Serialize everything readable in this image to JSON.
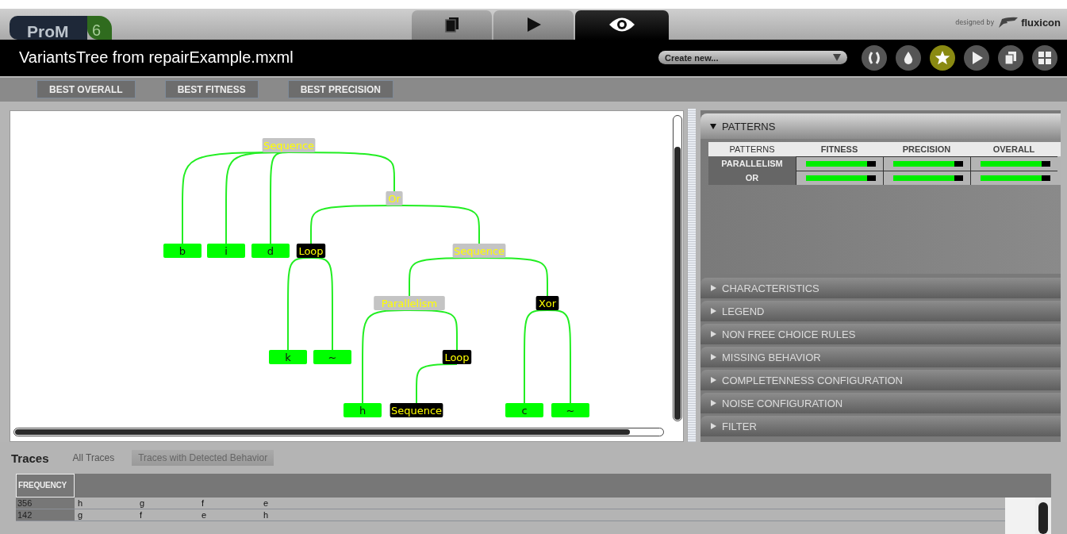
{
  "logo": {
    "name": "ProM",
    "version": "6"
  },
  "view_tabs": [
    {
      "selected": false
    },
    {
      "selected": false
    },
    {
      "selected": true
    }
  ],
  "credit": {
    "prefix": "designed by",
    "brand": "fluxicon"
  },
  "title": "VariantsTree from repairExample.mxml",
  "create_dropdown": {
    "value": "Create new..."
  },
  "action_buttons": [
    {
      "selected": false
    },
    {
      "selected": false
    },
    {
      "selected": true
    },
    {
      "selected": false
    },
    {
      "selected": false
    },
    {
      "selected": false
    }
  ],
  "toolbar_buttons": [
    "BEST OVERALL",
    "BEST FITNESS",
    "BEST PRECISION"
  ],
  "tree": {
    "root": {
      "label": "Sequence",
      "kind": "operator",
      "children": [
        {
          "label": "b",
          "kind": "leaf"
        },
        {
          "label": "i",
          "kind": "leaf"
        },
        {
          "label": "d",
          "kind": "leaf"
        },
        {
          "label": "Or",
          "kind": "operator",
          "children": [
            {
              "label": "Loop",
              "kind": "operator-dark",
              "children": [
                {
                  "label": "k",
                  "kind": "leaf"
                },
                {
                  "label": "~",
                  "kind": "leaf"
                }
              ]
            },
            {
              "label": "Sequence",
              "kind": "operator",
              "children": [
                {
                  "label": "Parallelism",
                  "kind": "operator",
                  "children": [
                    {
                      "label": "h",
                      "kind": "leaf"
                    },
                    {
                      "label": "Loop",
                      "kind": "operator-dark",
                      "children": [
                        {
                          "label": "Sequence",
                          "kind": "operator-dark"
                        }
                      ]
                    }
                  ]
                },
                {
                  "label": "Xor",
                  "kind": "operator-dark",
                  "children": [
                    {
                      "label": "c",
                      "kind": "leaf"
                    },
                    {
                      "label": "~",
                      "kind": "leaf"
                    }
                  ]
                }
              ]
            }
          ]
        }
      ]
    }
  },
  "sections": [
    {
      "title": "PATTERNS",
      "expanded": true,
      "table": {
        "columns": [
          "PATTERNS",
          "FITNESS",
          "PRECISION",
          "OVERALL"
        ],
        "rows": [
          {
            "name": "PARALLELISM",
            "scores": [
              {
                "level": 0.88
              },
              {
                "level": 0.88
              },
              {
                "level": 0.88
              }
            ]
          },
          {
            "name": "OR",
            "scores": [
              {
                "level": 0.88
              },
              {
                "level": 0.88
              },
              {
                "level": 0.88
              }
            ]
          }
        ]
      }
    },
    {
      "title": "CHARACTERISTICS",
      "expanded": false
    },
    {
      "title": "LEGEND",
      "expanded": false
    },
    {
      "title": "NON FREE CHOICE RULES",
      "expanded": false
    },
    {
      "title": "MISSING BEHAVIOR",
      "expanded": false
    },
    {
      "title": "COMPLETENNESS CONFIGURATION",
      "expanded": false
    },
    {
      "title": "NOISE CONFIGURATION",
      "expanded": false
    },
    {
      "title": "FILTER",
      "expanded": false
    }
  ],
  "traces": {
    "heading": "Traces",
    "tabs": [
      {
        "label": "All Traces",
        "selected": false
      },
      {
        "label": "Traces with Detected Behavior",
        "selected": true
      }
    ],
    "column": "FREQUENCY",
    "rows": [
      {
        "frequency": "356",
        "events": [
          "h",
          "g",
          "f",
          "e"
        ]
      },
      {
        "frequency": "142",
        "events": [
          "g",
          "f",
          "e",
          "h"
        ]
      }
    ]
  }
}
